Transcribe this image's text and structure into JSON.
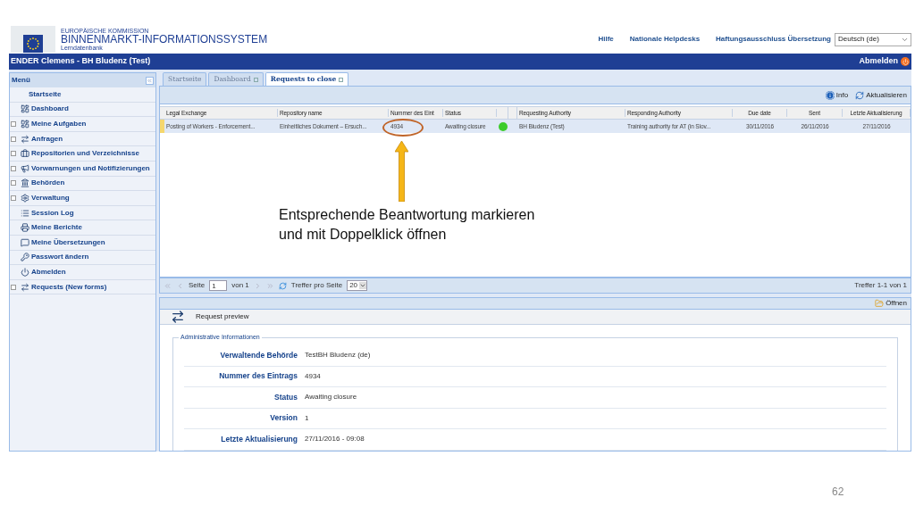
{
  "header": {
    "logo_lines": [
      "EUROPÄISCHE KOMMISSION",
      "BINNENMARKT-INFORMATIONSSYSTEM",
      "Lerndatenbank"
    ],
    "links": [
      "Hilfe",
      "Nationale Helpdesks",
      "Haftungsausschluss Übersetzung"
    ],
    "language": "Deutsch (de)"
  },
  "user_bar": {
    "user": "ENDER Clemens - BH Bludenz (Test)",
    "logout": "Abmelden"
  },
  "menu": {
    "title": "Menü",
    "items": [
      {
        "label": "Startseite",
        "expandable": false
      },
      {
        "label": "Dashboard",
        "expandable": false
      },
      {
        "label": "Meine Aufgaben",
        "expandable": true
      },
      {
        "label": "Anfragen",
        "expandable": true
      },
      {
        "label": "Repositorien und Verzeichnisse",
        "expandable": true
      },
      {
        "label": "Vorwarnungen und Notifizierungen",
        "expandable": true
      },
      {
        "label": "Behörden",
        "expandable": true
      },
      {
        "label": "Verwaltung",
        "expandable": true
      },
      {
        "label": "Session Log",
        "expandable": false
      },
      {
        "label": "Meine Berichte",
        "expandable": false
      },
      {
        "label": "Meine Übersetzungen",
        "expandable": false
      },
      {
        "label": "Passwort ändern",
        "expandable": false
      },
      {
        "label": "Abmelden",
        "expandable": false
      },
      {
        "label": "Requests (New forms)",
        "expandable": true
      }
    ]
  },
  "tabs": [
    {
      "label": "Startseite",
      "selected": false,
      "closable": false
    },
    {
      "label": "Dashboard",
      "selected": false,
      "closable": true
    },
    {
      "label": "Requests to close",
      "selected": true,
      "closable": true
    }
  ],
  "toolbar": [
    "Info",
    "Aktualisieren"
  ],
  "table": {
    "columns": [
      "Legal Exchange",
      "Repository name",
      "Nummer des Eint",
      "Status",
      "Requesting Authority",
      "Responding Authority",
      "Due date",
      "Sent",
      "Letzte Aktualisierung"
    ],
    "rows": [
      {
        "selected": true,
        "cells": [
          "Posting of Workers - Enforcement...",
          "Einheitliches Dokument – Ersuch...",
          "4934",
          "Awaiting closure",
          "BH Bludenz (Test)",
          "Training authority for AT (in Slov...",
          "30/11/2016",
          "26/11/2016",
          "27/11/2016"
        ]
      }
    ]
  },
  "pager": {
    "page_label": "Seite",
    "page": "1",
    "of": "von 1",
    "per_page_label": "Treffer pro Seite",
    "per_page": "20",
    "summary": "Treffer 1-1 von 1"
  },
  "detail": {
    "action": "Öffnen",
    "title": "Request preview",
    "legend": "Administrative Informationen",
    "fields": [
      {
        "label": "Verwaltende Behörde",
        "value": "TestBH Bludenz (de)"
      },
      {
        "label": "Nummer des Eintrags",
        "value": "4934"
      },
      {
        "label": "Status",
        "value": "Awaiting closure"
      },
      {
        "label": "Version",
        "value": "1"
      },
      {
        "label": "Letzte Aktualisierung",
        "value": "27/11/2016 - 09:08"
      }
    ]
  },
  "annotation": "Entsprechende Beantwortung markieren und mit Doppelklick öffnen",
  "slide_number": "62"
}
